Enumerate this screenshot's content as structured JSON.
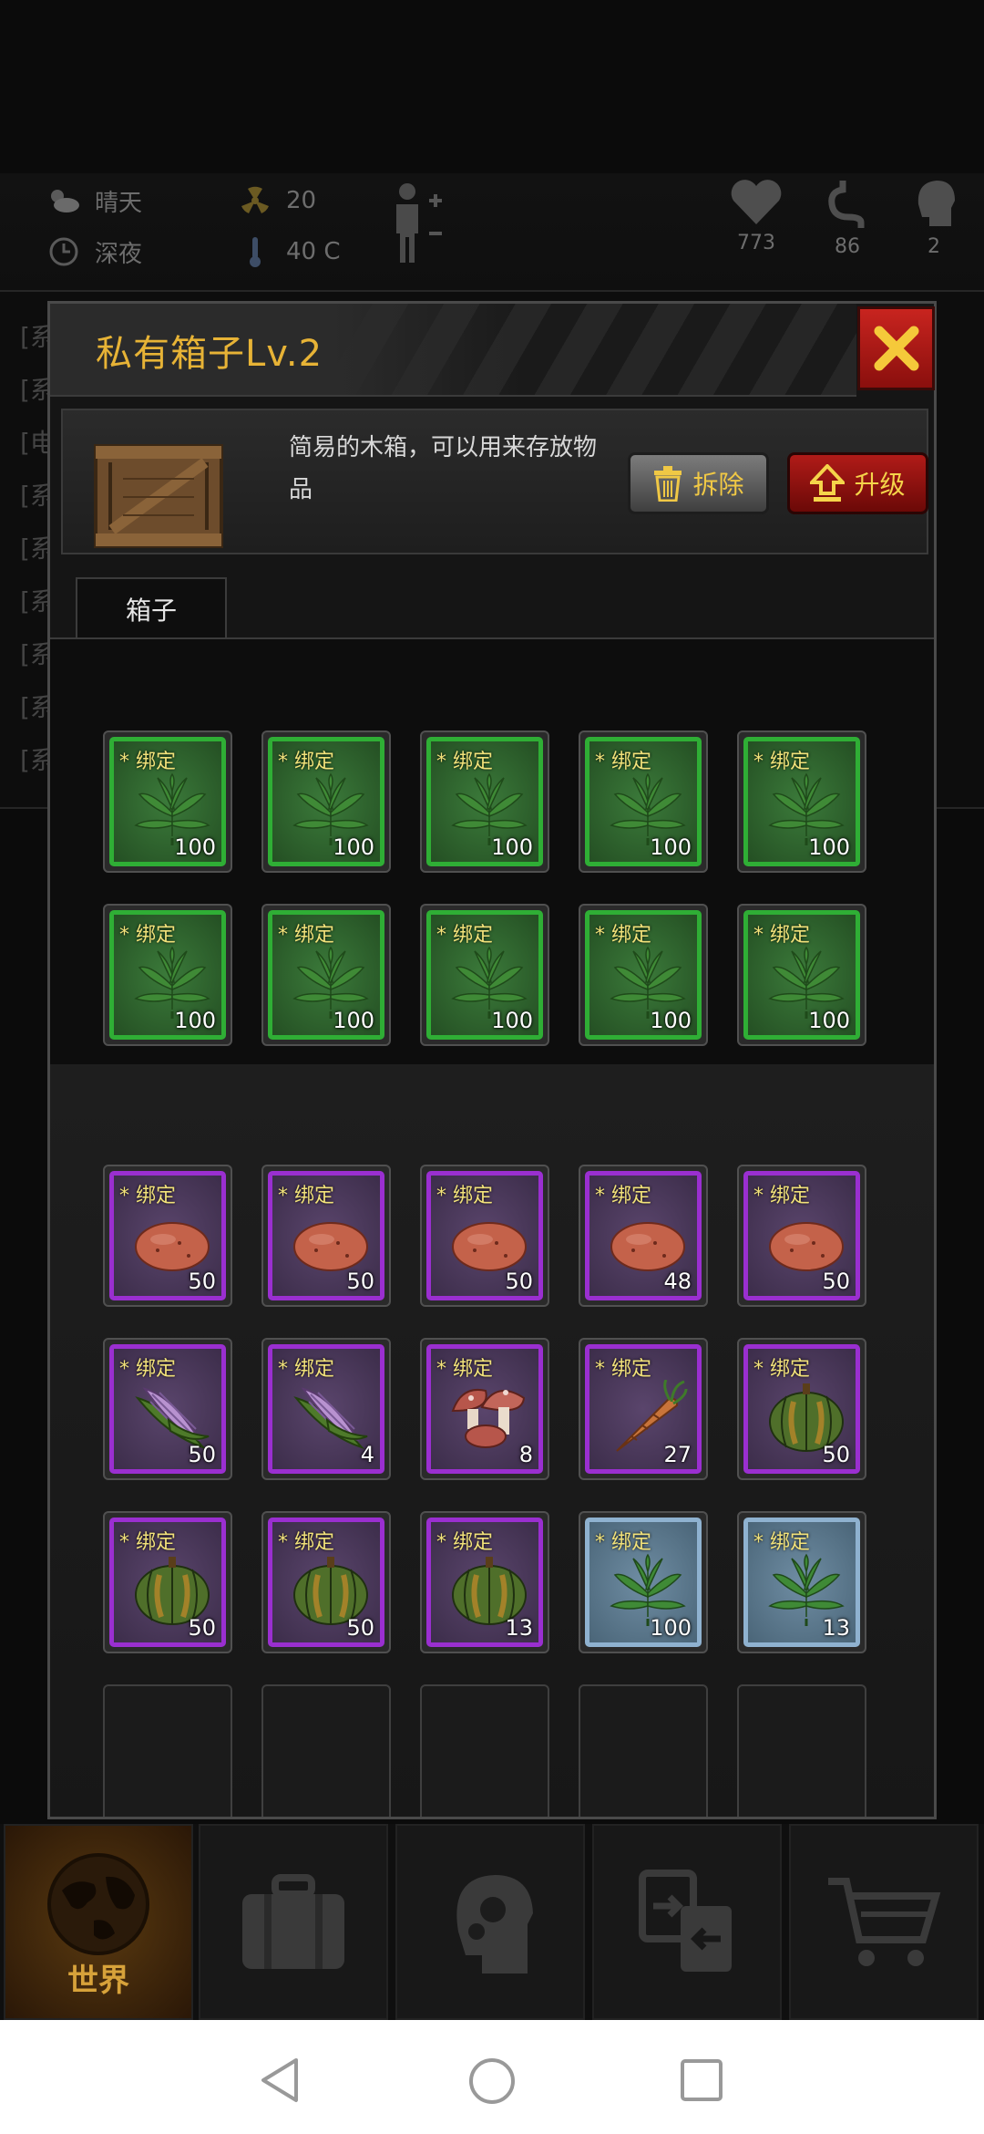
{
  "status": {
    "weather": "晴天",
    "time": "深夜",
    "radiation": "20",
    "temperature": "40 C",
    "health": "773",
    "hunger": "86",
    "mind": "2"
  },
  "background_log_prefixes": [
    "[系",
    "[系",
    "[电",
    "[系",
    "[系",
    "[系",
    "[系",
    "[系",
    "[系"
  ],
  "modal": {
    "title": "私有箱子Lv.2",
    "description": "简易的木箱，可以用来存放物品",
    "dismantle_label": "拆除",
    "upgrade_label": "升级",
    "tab_label": "箱子"
  },
  "bind_tag": "* 绑定",
  "box_items": [
    {
      "item": "hemp",
      "rarity": "green",
      "qty": "100"
    },
    {
      "item": "hemp",
      "rarity": "green",
      "qty": "100"
    },
    {
      "item": "hemp",
      "rarity": "green",
      "qty": "100"
    },
    {
      "item": "hemp",
      "rarity": "green",
      "qty": "100"
    },
    {
      "item": "hemp",
      "rarity": "green",
      "qty": "100"
    },
    {
      "item": "hemp",
      "rarity": "green",
      "qty": "100"
    },
    {
      "item": "hemp",
      "rarity": "green",
      "qty": "100"
    },
    {
      "item": "hemp",
      "rarity": "green",
      "qty": "100"
    },
    {
      "item": "hemp",
      "rarity": "green",
      "qty": "100"
    },
    {
      "item": "hemp",
      "rarity": "green",
      "qty": "100"
    }
  ],
  "bag_items": [
    {
      "item": "potato",
      "rarity": "purple",
      "qty": "50"
    },
    {
      "item": "potato",
      "rarity": "purple",
      "qty": "50"
    },
    {
      "item": "potato",
      "rarity": "purple",
      "qty": "50"
    },
    {
      "item": "potato",
      "rarity": "purple",
      "qty": "48"
    },
    {
      "item": "potato",
      "rarity": "purple",
      "qty": "50"
    },
    {
      "item": "corn",
      "rarity": "purple",
      "qty": "50"
    },
    {
      "item": "corn",
      "rarity": "purple",
      "qty": "4"
    },
    {
      "item": "mushroom",
      "rarity": "purple",
      "qty": "8"
    },
    {
      "item": "carrot",
      "rarity": "purple",
      "qty": "27"
    },
    {
      "item": "pumpkin",
      "rarity": "purple",
      "qty": "50"
    },
    {
      "item": "pumpkin",
      "rarity": "purple",
      "qty": "50"
    },
    {
      "item": "pumpkin",
      "rarity": "purple",
      "qty": "50"
    },
    {
      "item": "pumpkin",
      "rarity": "purple",
      "qty": "13"
    },
    {
      "item": "hemp",
      "rarity": "blue",
      "qty": "100"
    },
    {
      "item": "hemp",
      "rarity": "blue",
      "qty": "13"
    }
  ],
  "empty_slots": 5,
  "nav": [
    {
      "icon": "globe-icon",
      "label": "世界",
      "active": true
    },
    {
      "icon": "briefcase-icon",
      "label": "",
      "active": false
    },
    {
      "icon": "head-gears-icon",
      "label": "",
      "active": false
    },
    {
      "icon": "transfer-icon",
      "label": "",
      "active": false
    },
    {
      "icon": "cart-icon",
      "label": "",
      "active": false
    }
  ],
  "colors": {
    "title_gold": "#e7b336",
    "rarity_green": "#2fae35",
    "rarity_purple": "#9a2fd0",
    "rarity_blue": "#8fb2d0",
    "close_red": "#c8241f"
  }
}
